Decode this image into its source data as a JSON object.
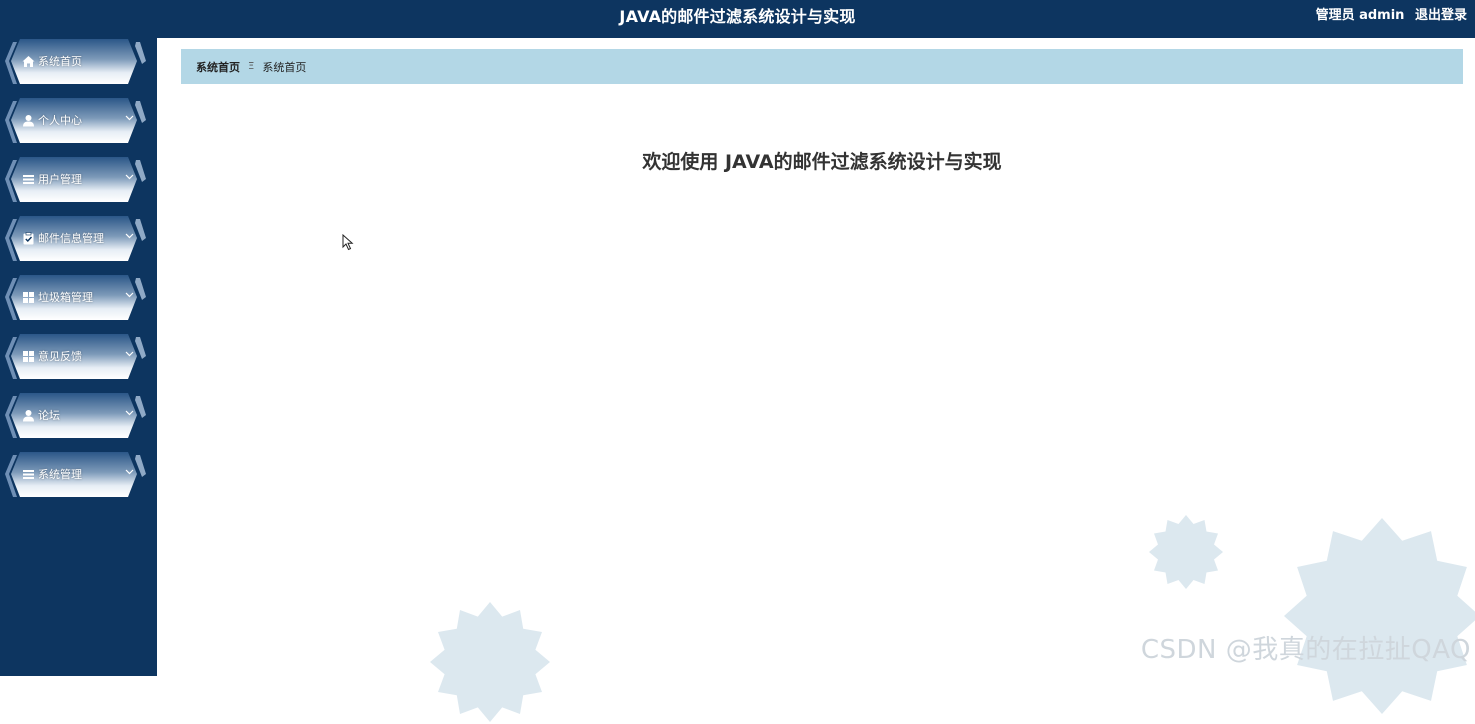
{
  "header": {
    "title": "JAVA的邮件过滤系统设计与实现",
    "user_role": "管理员 admin",
    "logout_label": "退出登录"
  },
  "sidebar": {
    "items": [
      {
        "label": "系统首页",
        "icon": "home-icon",
        "has_submenu": false
      },
      {
        "label": "个人中心",
        "icon": "user-icon",
        "has_submenu": true
      },
      {
        "label": "用户管理",
        "icon": "list-icon",
        "has_submenu": true
      },
      {
        "label": "邮件信息管理",
        "icon": "clipboard-check-icon",
        "has_submenu": true
      },
      {
        "label": "垃圾箱管理",
        "icon": "grid-icon",
        "has_submenu": true
      },
      {
        "label": "意见反馈",
        "icon": "grid-icon",
        "has_submenu": true
      },
      {
        "label": "论坛",
        "icon": "user-icon",
        "has_submenu": true
      },
      {
        "label": "系统管理",
        "icon": "list-icon",
        "has_submenu": true
      }
    ]
  },
  "breadcrumb": {
    "home": "系统首页",
    "separator": "Ξ",
    "current": "系统首页"
  },
  "main": {
    "welcome": "欢迎使用 JAVA的邮件过滤系统设计与实现"
  },
  "watermark": "CSDN @我真的在拉扯QAQ",
  "colors": {
    "sidebar_bg": "#0d3560",
    "breadcrumb_bg": "#b3d7e6",
    "gear_decor": "#dce8ef"
  }
}
